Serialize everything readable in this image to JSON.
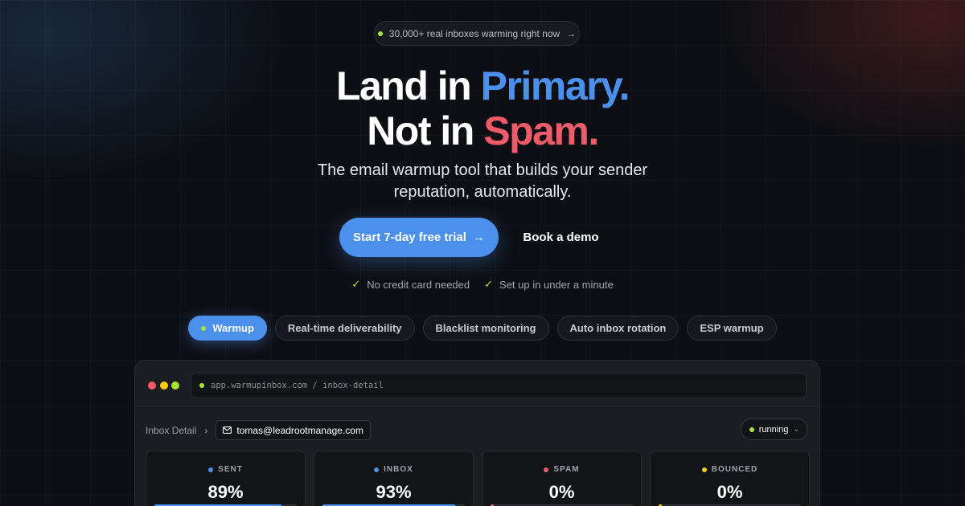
{
  "announcement": {
    "text": "30,000+ real inboxes warming right now",
    "arrow": "→"
  },
  "hero": {
    "line1_prefix": "Land in",
    "line1_highlight": "Primary.",
    "line2_prefix": "Not in",
    "line2_highlight": "Spam.",
    "sub_line1": "The email warmup tool that builds your sender",
    "sub_line2": "reputation, automatically."
  },
  "cta": {
    "primary": "Start 7-day free trial",
    "primary_arrow": "→",
    "secondary": "Book a demo"
  },
  "perks": [
    "No credit card needed",
    "Set up in under a minute"
  ],
  "tabs": [
    {
      "label": "Warmup",
      "active": true
    },
    {
      "label": "Real-time deliverability",
      "active": false
    },
    {
      "label": "Blacklist monitoring",
      "active": false
    },
    {
      "label": "Auto inbox rotation",
      "active": false
    },
    {
      "label": "ESP warmup",
      "active": false
    }
  ],
  "app": {
    "url": "app.warmupinbox.com / inbox-detail",
    "breadcrumb": "Inbox Detail",
    "breadcrumb_sep": "›",
    "email": "tomas@leadrootmanage.com",
    "status": "running",
    "stats": [
      {
        "label": "SENT",
        "value": "89%",
        "fill": 0.89,
        "color": "#4a90ec"
      },
      {
        "label": "INBOX",
        "value": "93%",
        "fill": 0.93,
        "color": "#4a90ec"
      },
      {
        "label": "SPAM",
        "value": "0%",
        "fill": 0.0,
        "color": "#ef5b6b"
      },
      {
        "label": "BOUNCED",
        "value": "0%",
        "fill": 0.0,
        "color": "#facc15"
      }
    ]
  },
  "colors": {
    "accent_blue": "#4a90ec",
    "accent_red": "#ef5b6b",
    "accent_green": "#a3e635",
    "accent_yellow": "#facc15"
  }
}
